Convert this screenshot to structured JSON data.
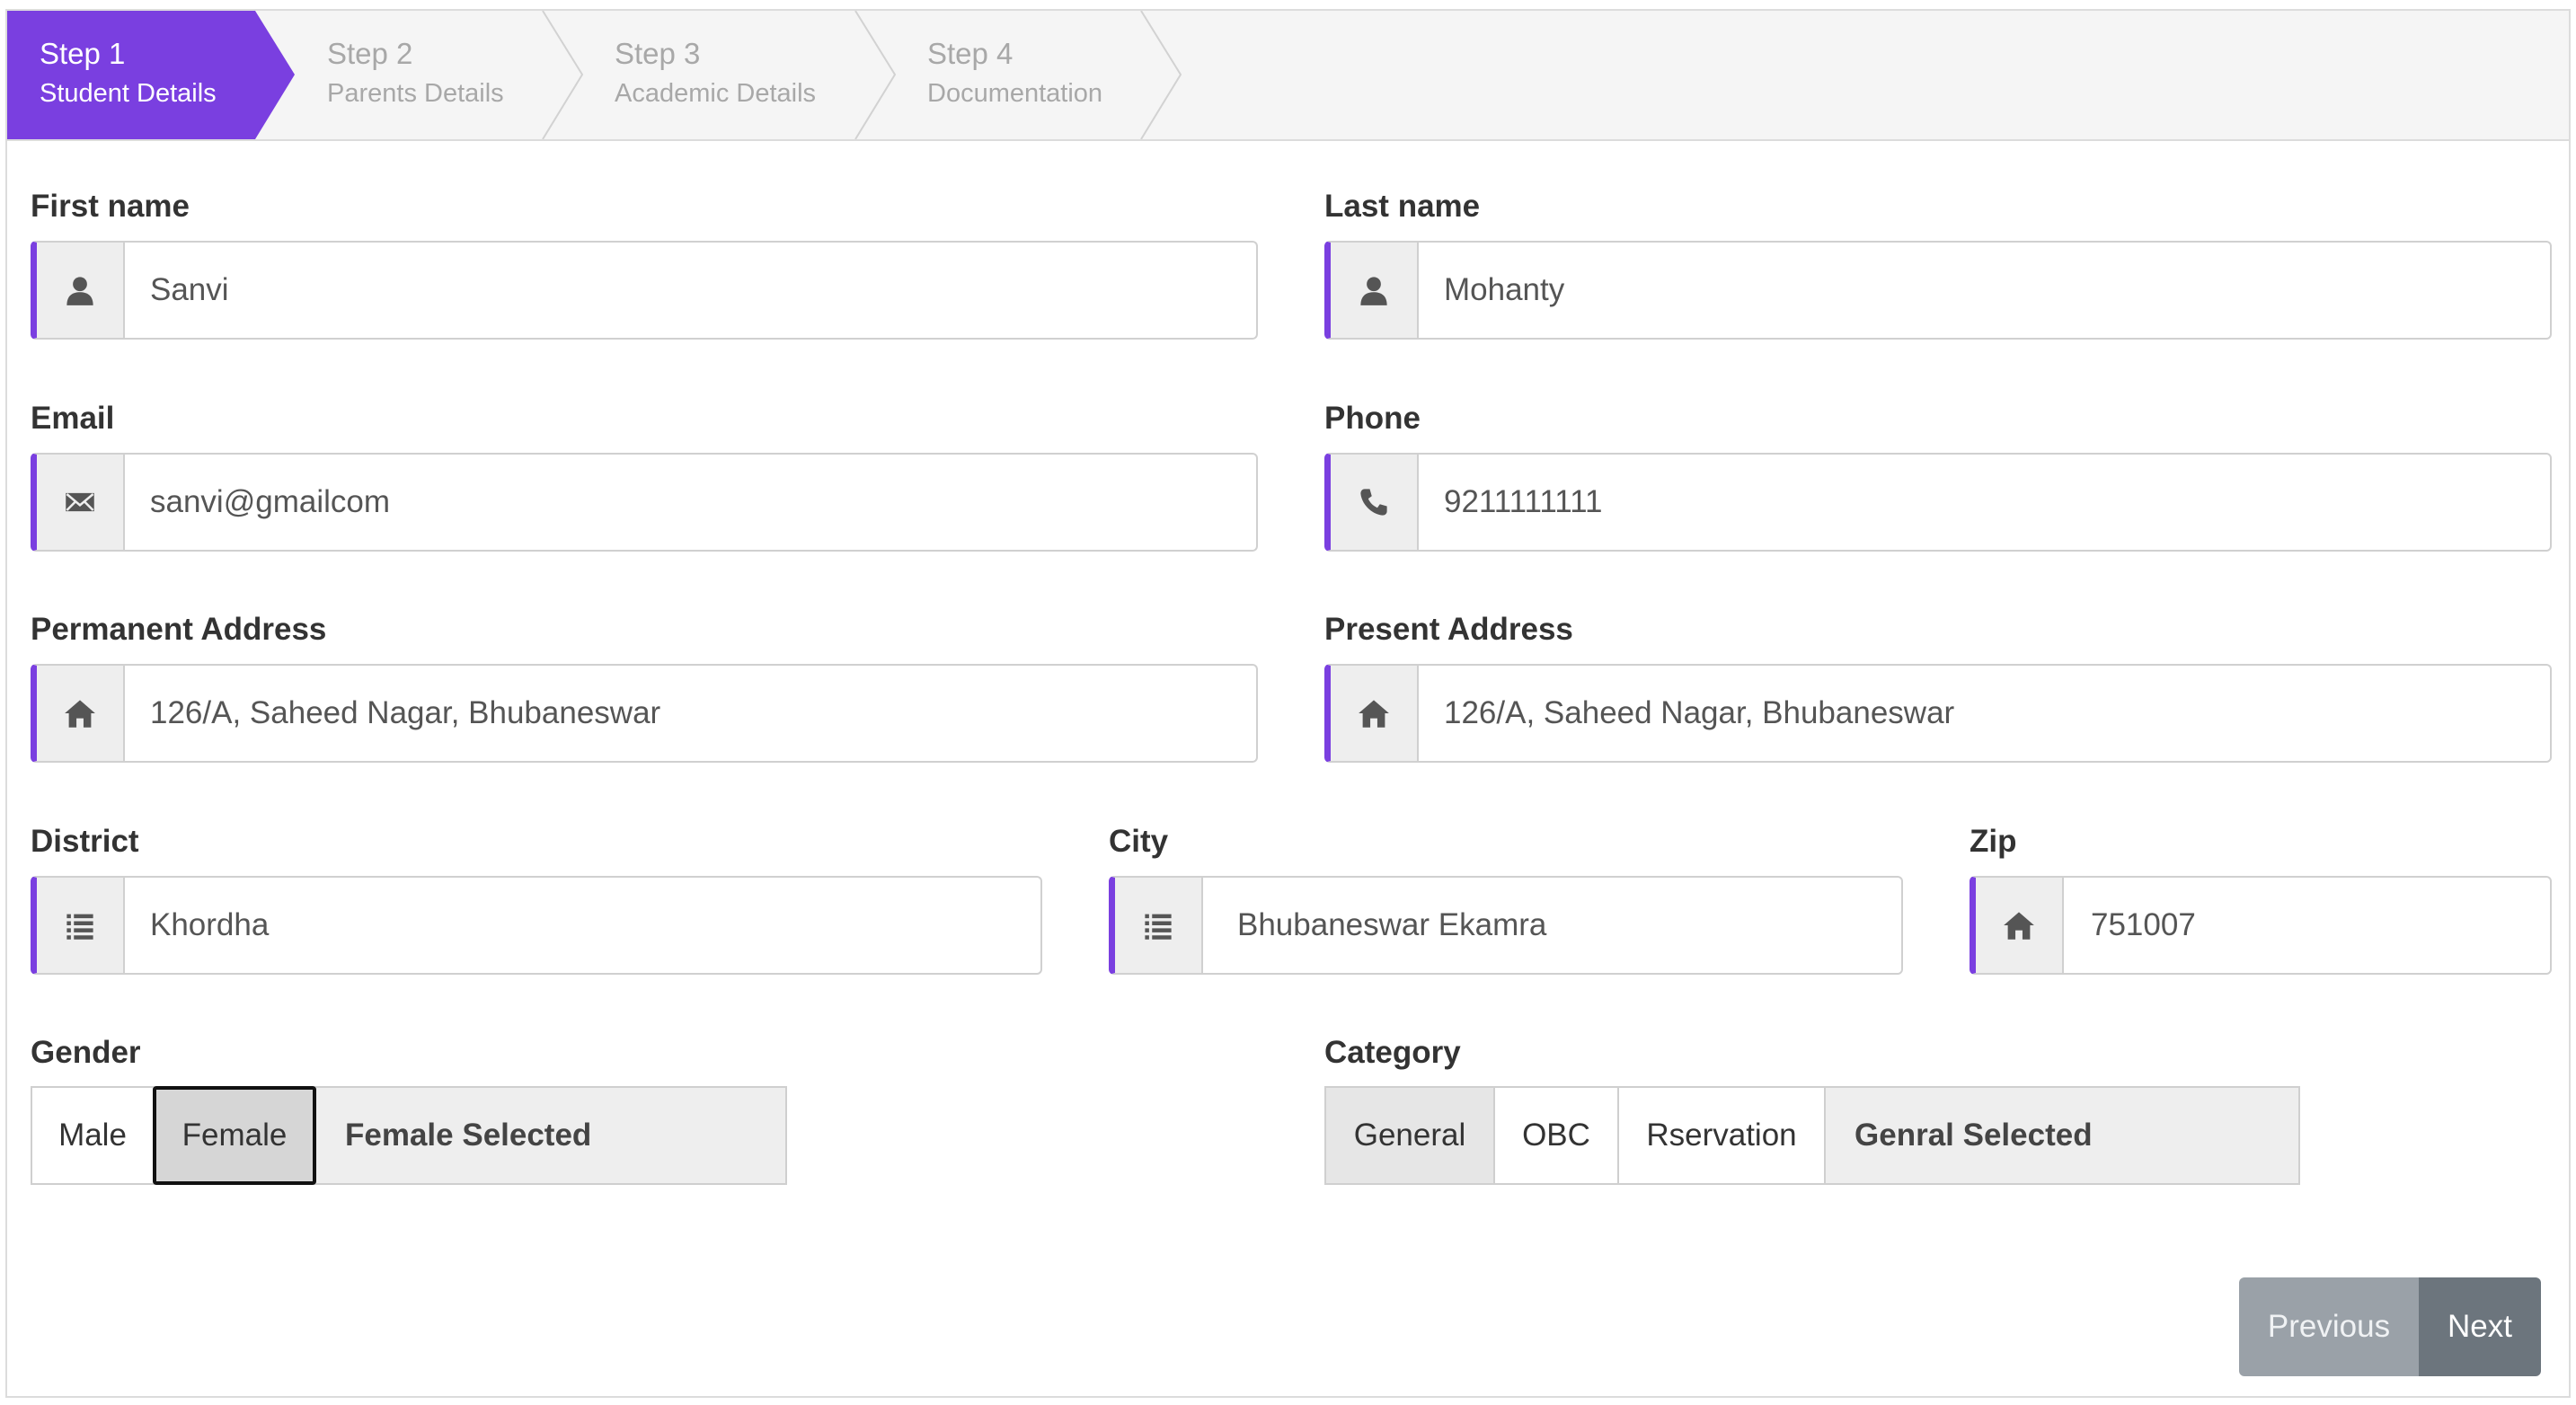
{
  "steps": [
    {
      "num": "Step 1",
      "name": "Student Details",
      "active": true
    },
    {
      "num": "Step 2",
      "name": "Parents Details",
      "active": false
    },
    {
      "num": "Step 3",
      "name": "Academic Details",
      "active": false
    },
    {
      "num": "Step 4",
      "name": "Documentation",
      "active": false
    }
  ],
  "colors": {
    "accent": "#7a3fe0",
    "prev": "#9aa1a8",
    "next": "#6c757d"
  },
  "fields": {
    "first_name": {
      "label": "First name",
      "value": "Sanvi",
      "icon": "user-icon"
    },
    "last_name": {
      "label": "Last name",
      "value": "Mohanty",
      "icon": "user-icon"
    },
    "email": {
      "label": "Email",
      "value": "sanvi@gmailcom",
      "icon": "envelope-icon"
    },
    "phone": {
      "label": "Phone",
      "value": "9211111111",
      "icon": "phone-icon"
    },
    "permanent_address": {
      "label": "Permanent Address",
      "value": "126/A, Saheed Nagar, Bhubaneswar",
      "icon": "home-icon"
    },
    "present_address": {
      "label": "Present Address",
      "value": "126/A, Saheed Nagar, Bhubaneswar",
      "icon": "home-icon"
    },
    "district": {
      "label": "District",
      "value": "Khordha",
      "icon": "list-icon"
    },
    "city": {
      "label": "City",
      "value": "Bhubaneswar Ekamra",
      "icon": "list-icon"
    },
    "zip": {
      "label": "Zip",
      "value": "751007",
      "icon": "home-icon"
    }
  },
  "gender": {
    "label": "Gender",
    "options": [
      "Male",
      "Female"
    ],
    "selected": "Female",
    "status": "Female Selected"
  },
  "category": {
    "label": "Category",
    "options": [
      "General",
      "OBC",
      "Rservation"
    ],
    "selected": "General",
    "status": "Genral Selected"
  },
  "nav": {
    "previous": "Previous",
    "next": "Next"
  }
}
